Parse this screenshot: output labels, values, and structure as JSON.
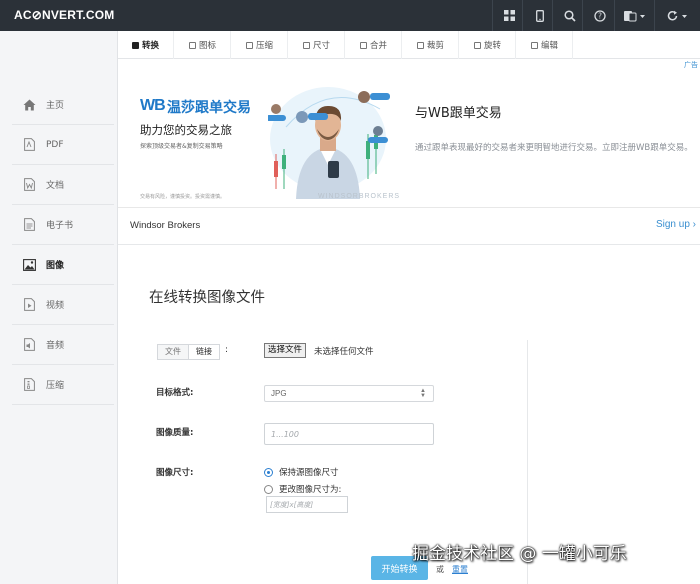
{
  "app": {
    "logo": "AC⊘NVERT.COM"
  },
  "topbar_icons": [
    "grid-icon",
    "mobile-icon",
    "search-icon",
    "help-icon",
    "language-icon",
    "refresh-icon"
  ],
  "tabs": [
    {
      "label": "转换",
      "active": true
    },
    {
      "label": "图标"
    },
    {
      "label": "压缩"
    },
    {
      "label": "尺寸"
    },
    {
      "label": "合并"
    },
    {
      "label": "裁剪"
    },
    {
      "label": "旋转"
    },
    {
      "label": "编辑"
    }
  ],
  "sidebar": {
    "items": [
      {
        "label": "主页",
        "icon": "home-icon"
      },
      {
        "label": "PDF",
        "icon": "pdf-icon"
      },
      {
        "label": "文档",
        "icon": "document-icon"
      },
      {
        "label": "电子书",
        "icon": "ebook-icon"
      },
      {
        "label": "图像",
        "icon": "image-icon",
        "active": true
      },
      {
        "label": "视频",
        "icon": "video-icon"
      },
      {
        "label": "音频",
        "icon": "audio-icon"
      },
      {
        "label": "压缩",
        "icon": "archive-icon"
      }
    ]
  },
  "ad": {
    "choice_mark": "广告",
    "logo_mark": "WB",
    "brand": "温莎跟单交易",
    "slogan": "助力您的交易之旅",
    "subtext": "探索顶级交易者&复制交易策略",
    "fine_print": "交易有风险，谨慎投资。投资需谨慎。",
    "watermark": "WINDSORBROKERS",
    "title": "与WB跟单交易",
    "description": "通过跟单表现最好的交易者来更明智地进行交易。立即注册WB跟单交易。",
    "company": "Windsor Brokers",
    "signup": "Sign up ›"
  },
  "form": {
    "title": "在线转换图像文件",
    "source_tabs": [
      "文件",
      "链接"
    ],
    "colon": ":",
    "choose_file_button": "选择文件",
    "no_file_text": "未选择任何文件",
    "target_format_label": "目标格式:",
    "target_format_value": "JPG",
    "quality_label": "图像质量:",
    "quality_placeholder": "1...100",
    "size_label": "图像尺寸:",
    "size_options": [
      {
        "label": "保持源图像尺寸",
        "selected": true
      },
      {
        "label": "更改图像尺寸为:",
        "selected": false
      }
    ],
    "dimension_placeholder": "[宽度]x[高度]",
    "convert_button": "开始转换",
    "or_text": "或",
    "reset_link": "重置"
  },
  "overlay_watermark": "掘金技术社区 @ 一罐小可乐"
}
